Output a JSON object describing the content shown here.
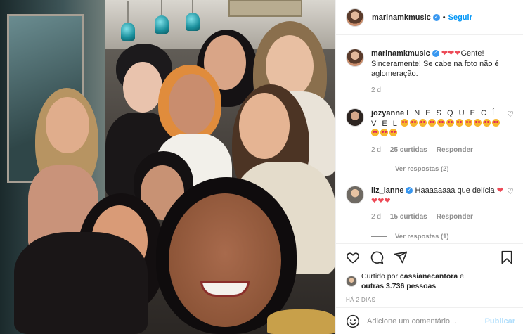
{
  "post": {
    "author": "marinamkmusic",
    "follow_label": "Seguir",
    "separator": "•",
    "photo_alt": "Foto"
  },
  "caption": {
    "username": "marinamkmusic",
    "text": "Gente! Sinceramente! Se cabe na foto não é aglomeração.",
    "time": "2 d"
  },
  "comments": [
    {
      "username": "jozyanne",
      "text": "I N E S Q U E C Í V E L",
      "time": "2 d",
      "likes": "25 curtidas",
      "reply_label": "Responder",
      "view_replies": "Ver respostas (2)"
    },
    {
      "username": "liz_lanne",
      "text": "Haaaaaaaa que delícia",
      "time": "2 d",
      "likes": "15 curtidas",
      "reply_label": "Responder",
      "view_replies": "Ver respostas (1)"
    }
  ],
  "likes": {
    "prefix": "Curtido por",
    "user": "cassianecantora",
    "middle": "e",
    "others": "outras 3.736 pessoas"
  },
  "timestamp": "HÁ 2 DIAS",
  "comment_box": {
    "placeholder": "Adicione um comentário...",
    "publish_label": "Publicar"
  },
  "colors": {
    "accent": "#0095f6",
    "heart": "#ed4956",
    "muted": "#8e8e8e"
  }
}
